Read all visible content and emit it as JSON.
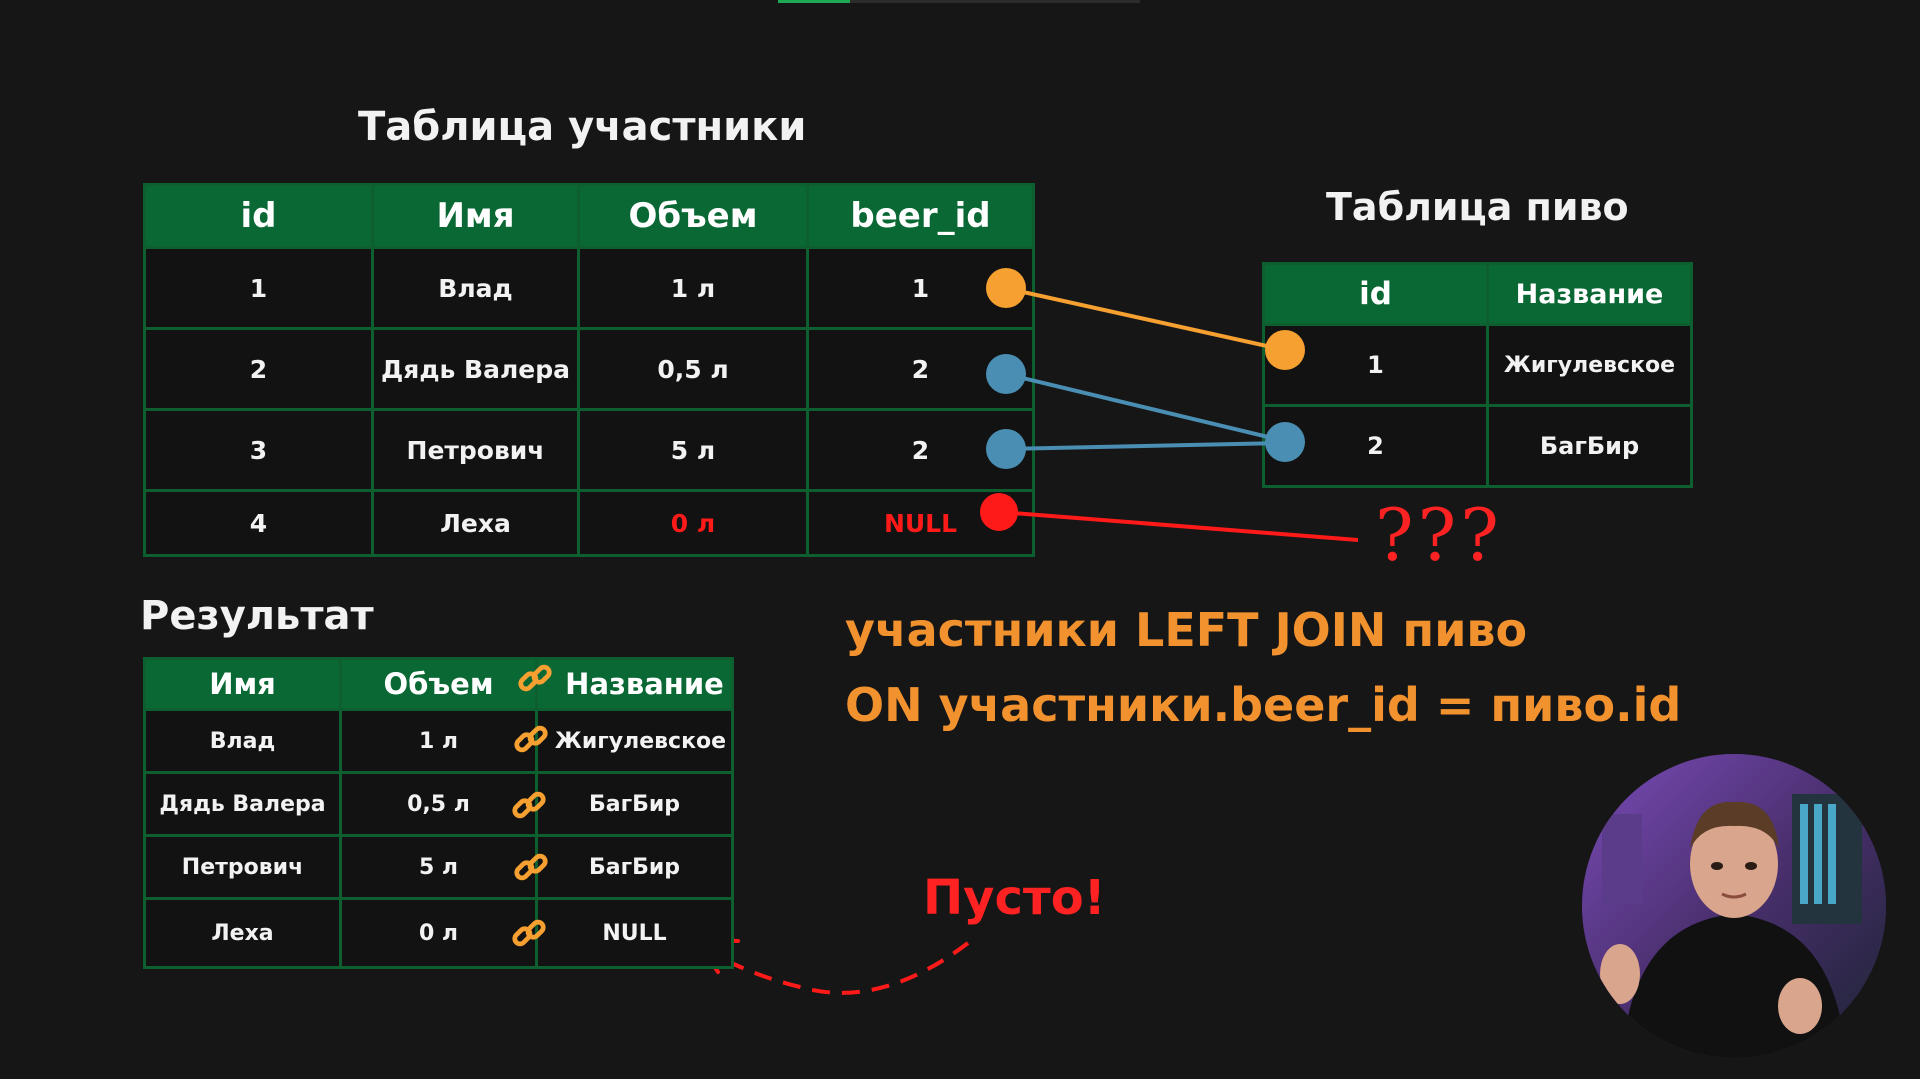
{
  "progress": 0.2,
  "participants": {
    "title": "Таблица участники",
    "headers": [
      "id",
      "Имя",
      "Объем",
      "beer_id"
    ],
    "rows": [
      [
        "1",
        "Влад",
        "1 л",
        "1"
      ],
      [
        "2",
        "Дядь Валера",
        "0,5 л",
        "2"
      ],
      [
        "3",
        "Петрович",
        "5 л",
        "2"
      ],
      [
        "4",
        "Леха",
        "0 л",
        "NULL"
      ]
    ]
  },
  "beer": {
    "title": "Таблица пиво",
    "headers": [
      "id",
      "Название"
    ],
    "rows": [
      [
        "1",
        "Жигулевское"
      ],
      [
        "2",
        "БагБир"
      ]
    ]
  },
  "result": {
    "title": "Результат",
    "headers": [
      "Имя",
      "Объем",
      "Название"
    ],
    "rows": [
      [
        "Влад",
        "1 л",
        "Жигулевское"
      ],
      [
        "Дядь Валера",
        "0,5 л",
        "БагБир"
      ],
      [
        "Петрович",
        "5 л",
        "БагБир"
      ],
      [
        "Леха",
        "0 л",
        "NULL"
      ]
    ]
  },
  "query": {
    "line1": "участники LEFT JOIN пиво",
    "line2": "ON участники.beer_id = пиво.id"
  },
  "annotations": {
    "question_marks": "???",
    "empty_label": "Пусто!"
  },
  "colors": {
    "header_green": "#0a6834",
    "orange": "#f5a030",
    "blue": "#4a8fb3",
    "red": "#ff1a1a",
    "query_orange": "#f2922f"
  },
  "icons": {
    "join_link": "link-icon"
  }
}
